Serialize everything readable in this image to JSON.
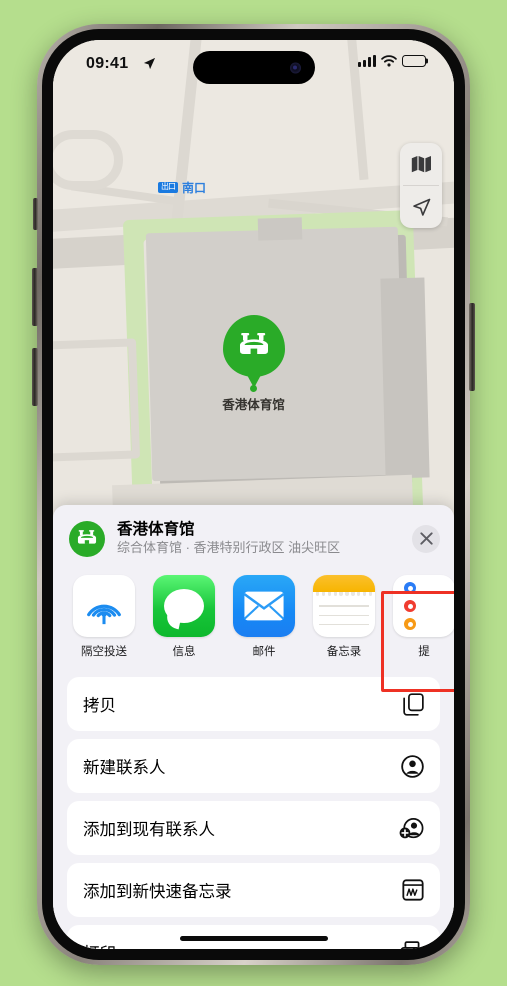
{
  "status_bar": {
    "time": "09:41",
    "location_icon": "location-arrow-icon",
    "signal_icon": "cellular-signal-icon",
    "wifi_icon": "wifi-icon",
    "battery_icon": "battery-icon"
  },
  "map": {
    "transit_badge": "出口",
    "transit_label": "南口",
    "poi_label": "香港体育馆",
    "poi_icon": "stadium-icon",
    "controls": [
      {
        "name": "map-type-button",
        "icon": "folded-map-icon"
      },
      {
        "name": "current-location-button",
        "icon": "navigation-arrow-icon"
      }
    ]
  },
  "share_sheet": {
    "title": "香港体育馆",
    "subtitle": "综合体育馆 · 香港特别行政区 油尖旺区",
    "avatar_icon": "stadium-icon",
    "close_icon": "close-icon",
    "apps": [
      {
        "label": "隔空投送",
        "icon": "airdrop-icon"
      },
      {
        "label": "信息",
        "icon": "messages-icon"
      },
      {
        "label": "邮件",
        "icon": "mail-icon"
      },
      {
        "label": "备忘录",
        "icon": "notes-icon"
      },
      {
        "label": "提",
        "icon": "reminders-icon"
      }
    ],
    "highlighted_app": "备忘录",
    "highlight_color": "#ee3124",
    "actions": [
      {
        "label": "拷贝",
        "icon": "copy-icon"
      },
      {
        "label": "新建联系人",
        "icon": "person-circle-icon"
      },
      {
        "label": "添加到现有联系人",
        "icon": "person-add-icon"
      },
      {
        "label": "添加到新快速备忘录",
        "icon": "quick-note-icon"
      },
      {
        "label": "打印",
        "icon": "printer-icon"
      }
    ]
  },
  "colors": {
    "background": "#b5de8d",
    "poi_green": "#2aab28",
    "accent_red": "#ee3124"
  }
}
